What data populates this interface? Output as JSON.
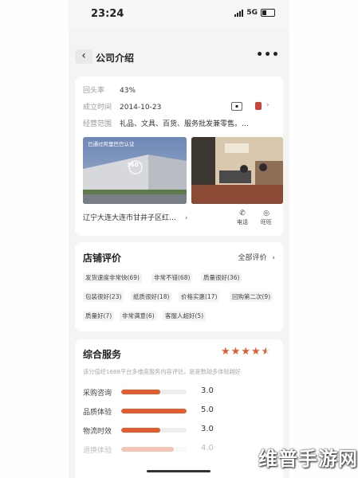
{
  "status": {
    "time": "23:24",
    "network": "5G"
  },
  "nav": {
    "title": "公司介绍",
    "more": "•••",
    "back": "‹"
  },
  "company": {
    "rows": [
      {
        "label": "回头率",
        "value": "43%"
      },
      {
        "label": "成立时间",
        "value": "2014-10-23"
      },
      {
        "label": "经营范围",
        "value": "礼品、文具、百货、服务批发兼零售。…"
      }
    ],
    "photo_caption": "已通过阿里巴巴认证",
    "photo_360": "360°",
    "address": "辽宁大连大连市甘井子区红…",
    "address_arrow": "›",
    "phone_label": "电话",
    "wangwang_label": "旺旺"
  },
  "reviews": {
    "title": "店铺评价",
    "all_label": "全部评价",
    "tags": [
      "发货速度非常快(69)",
      "非常不错(68)",
      "质量很好(36)",
      "包装很好(23)",
      "纸质很好(18)",
      "价格实惠(17)",
      "回购第二次(9)",
      "质量好(7)",
      "非常满意(6)",
      "客服人超好(5)"
    ]
  },
  "service": {
    "title": "综合服务",
    "desc": "该分值经1688平台多维度服务内容评估，是是数越多体验越好",
    "rating_stars": 4.5,
    "items": [
      {
        "label": "采购咨询",
        "score": "3.0",
        "fraction": 0.6
      },
      {
        "label": "品质体验",
        "score": "5.0",
        "fraction": 1.0
      },
      {
        "label": "物流时效",
        "score": "3.0",
        "fraction": 0.6
      },
      {
        "label": "退换体验",
        "score": "4.0",
        "fraction": 0.8
      }
    ]
  },
  "watermark": "维普手游网",
  "colors": {
    "accent": "#e65a2c",
    "star": "#e65a2c"
  }
}
